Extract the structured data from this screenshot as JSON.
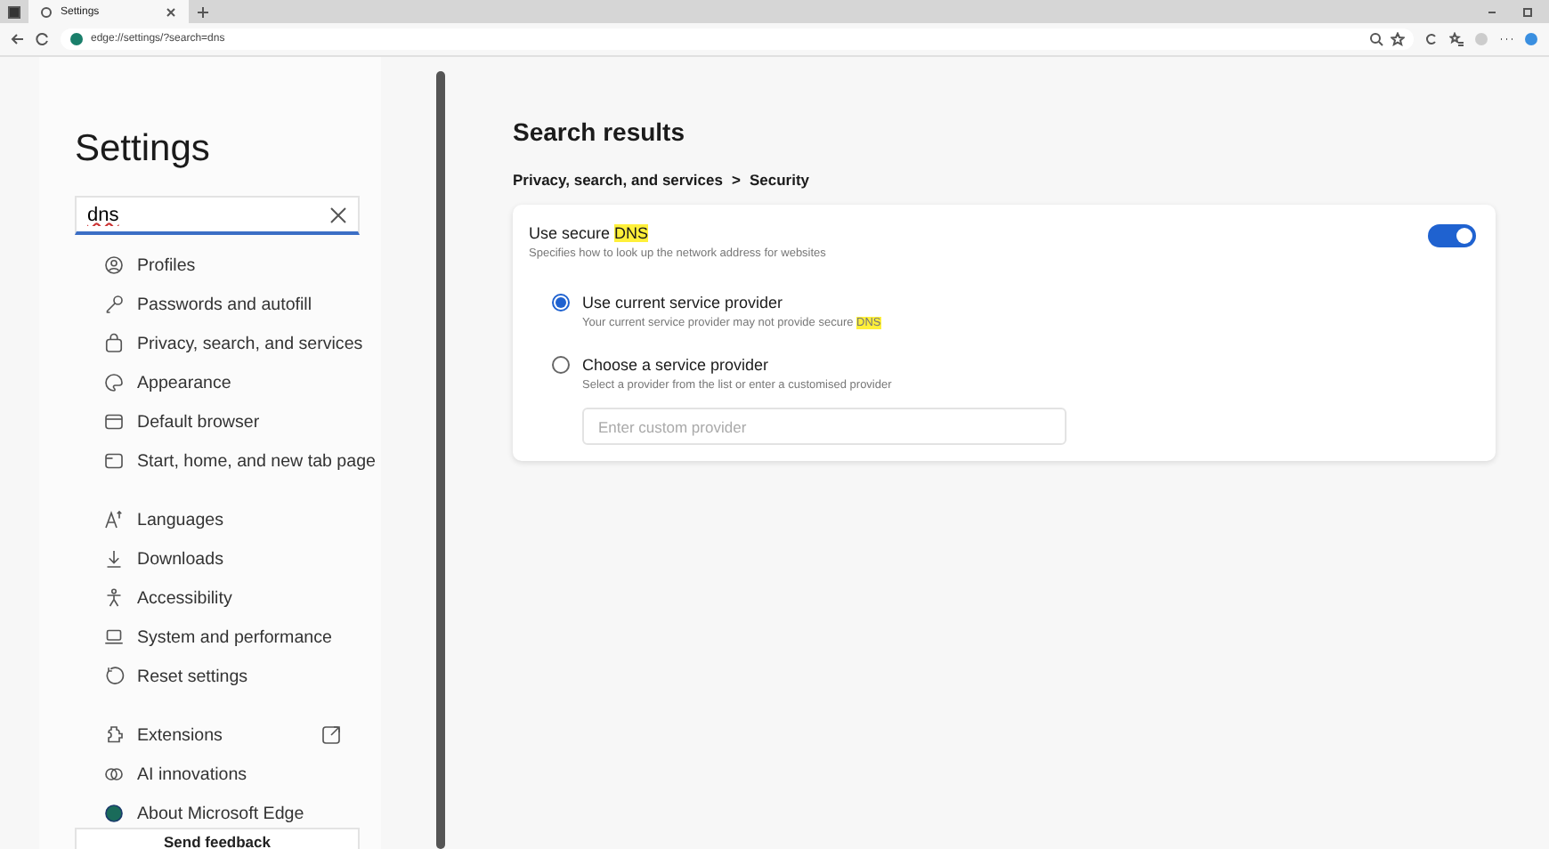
{
  "browser": {
    "tab_title": "Settings",
    "address": "edge://settings/?search=dns"
  },
  "sidebar": {
    "title": "Settings",
    "search": {
      "value": "dns"
    },
    "groups": [
      [
        {
          "label": "Profiles",
          "external": false
        },
        {
          "label": "Passwords and autofill",
          "external": false
        },
        {
          "label": "Privacy, search, and services",
          "external": false
        },
        {
          "label": "Appearance",
          "external": false
        },
        {
          "label": "Default browser",
          "external": false
        },
        {
          "label": "Start, home, and new tab page",
          "external": false
        }
      ],
      [
        {
          "label": "Languages",
          "external": false
        },
        {
          "label": "Downloads",
          "external": false
        },
        {
          "label": "Accessibility",
          "external": false
        },
        {
          "label": "System and performance",
          "external": false
        },
        {
          "label": "Reset settings",
          "external": false
        }
      ],
      [
        {
          "label": "Extensions",
          "external": true
        },
        {
          "label": "AI innovations",
          "external": false
        },
        {
          "label": "About Microsoft Edge",
          "external": false
        }
      ]
    ],
    "feedback_button": "Send feedback"
  },
  "main": {
    "title": "Search results",
    "breadcrumb": {
      "parent": "Privacy, search, and services",
      "separator": ">",
      "current": "Security"
    },
    "setting": {
      "title": {
        "text": "Use secure ",
        "highlight": "DNS"
      },
      "description": "Specifies how to look up the network address for websites",
      "on": true,
      "options": [
        {
          "label": "Use current service provider",
          "description": {
            "text": "Your current service provider may not provide secure ",
            "highlight": "DNS"
          },
          "selected": true
        },
        {
          "label": "Choose a service provider",
          "description": {
            "text": "Select a provider from the list or enter a customised provider"
          },
          "selected": false
        }
      ],
      "provider_field": {
        "placeholder": "Enter custom provider"
      }
    }
  }
}
